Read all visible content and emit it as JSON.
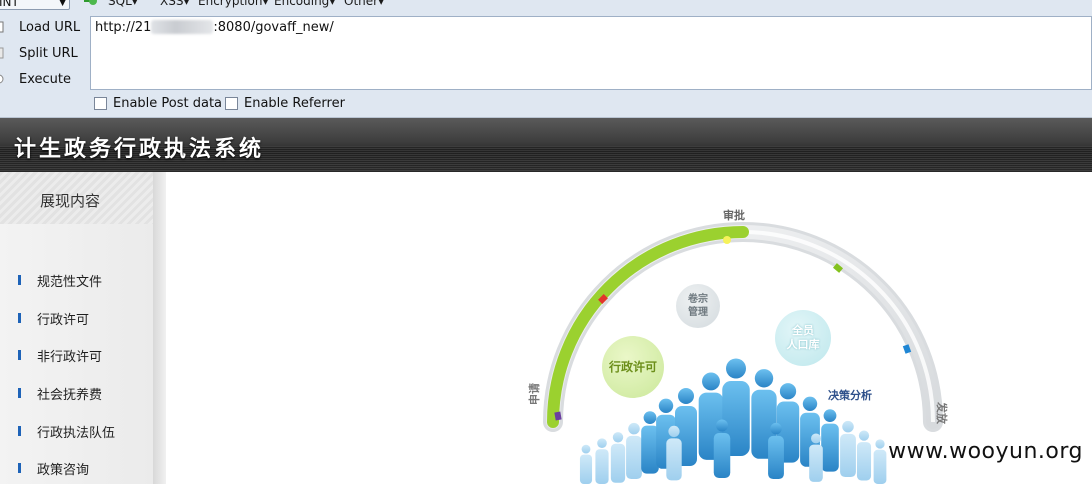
{
  "hackbar": {
    "select_label": "INT",
    "menu": [
      "SQL",
      "XSS",
      "Encryption",
      "Encoding",
      "Other"
    ],
    "load_url": "Load URL",
    "split_url": "Split URL",
    "execute": "Execute",
    "url_prefix": "http://21",
    "url_suffix": ":8080/govaff_new/",
    "enable_post": "Enable Post data",
    "enable_referrer": "Enable Referrer"
  },
  "site": {
    "title": "计生政务行政执法系统"
  },
  "sidebar": {
    "title": "展现内容",
    "items": [
      {
        "label": "规范性文件"
      },
      {
        "label": "行政许可"
      },
      {
        "label": "非行政许可"
      },
      {
        "label": "社会抚养费"
      },
      {
        "label": "行政执法队伍"
      },
      {
        "label": "政策咨询"
      }
    ]
  },
  "dashboard": {
    "arc_labels": {
      "start": "申请",
      "top": "审批",
      "end": "发放"
    },
    "bubbles": {
      "permit": "行政许可",
      "archive_1": "卷宗",
      "archive_2": "管理",
      "population_1": "全员",
      "population_2": "人口库"
    },
    "decision": "决策分析",
    "progress_fraction": 0.5,
    "colors": {
      "progress": "#9bd12f",
      "track": "#e6e8ea",
      "people": "#4a9fd8"
    }
  },
  "watermark": "www.wooyun.org"
}
